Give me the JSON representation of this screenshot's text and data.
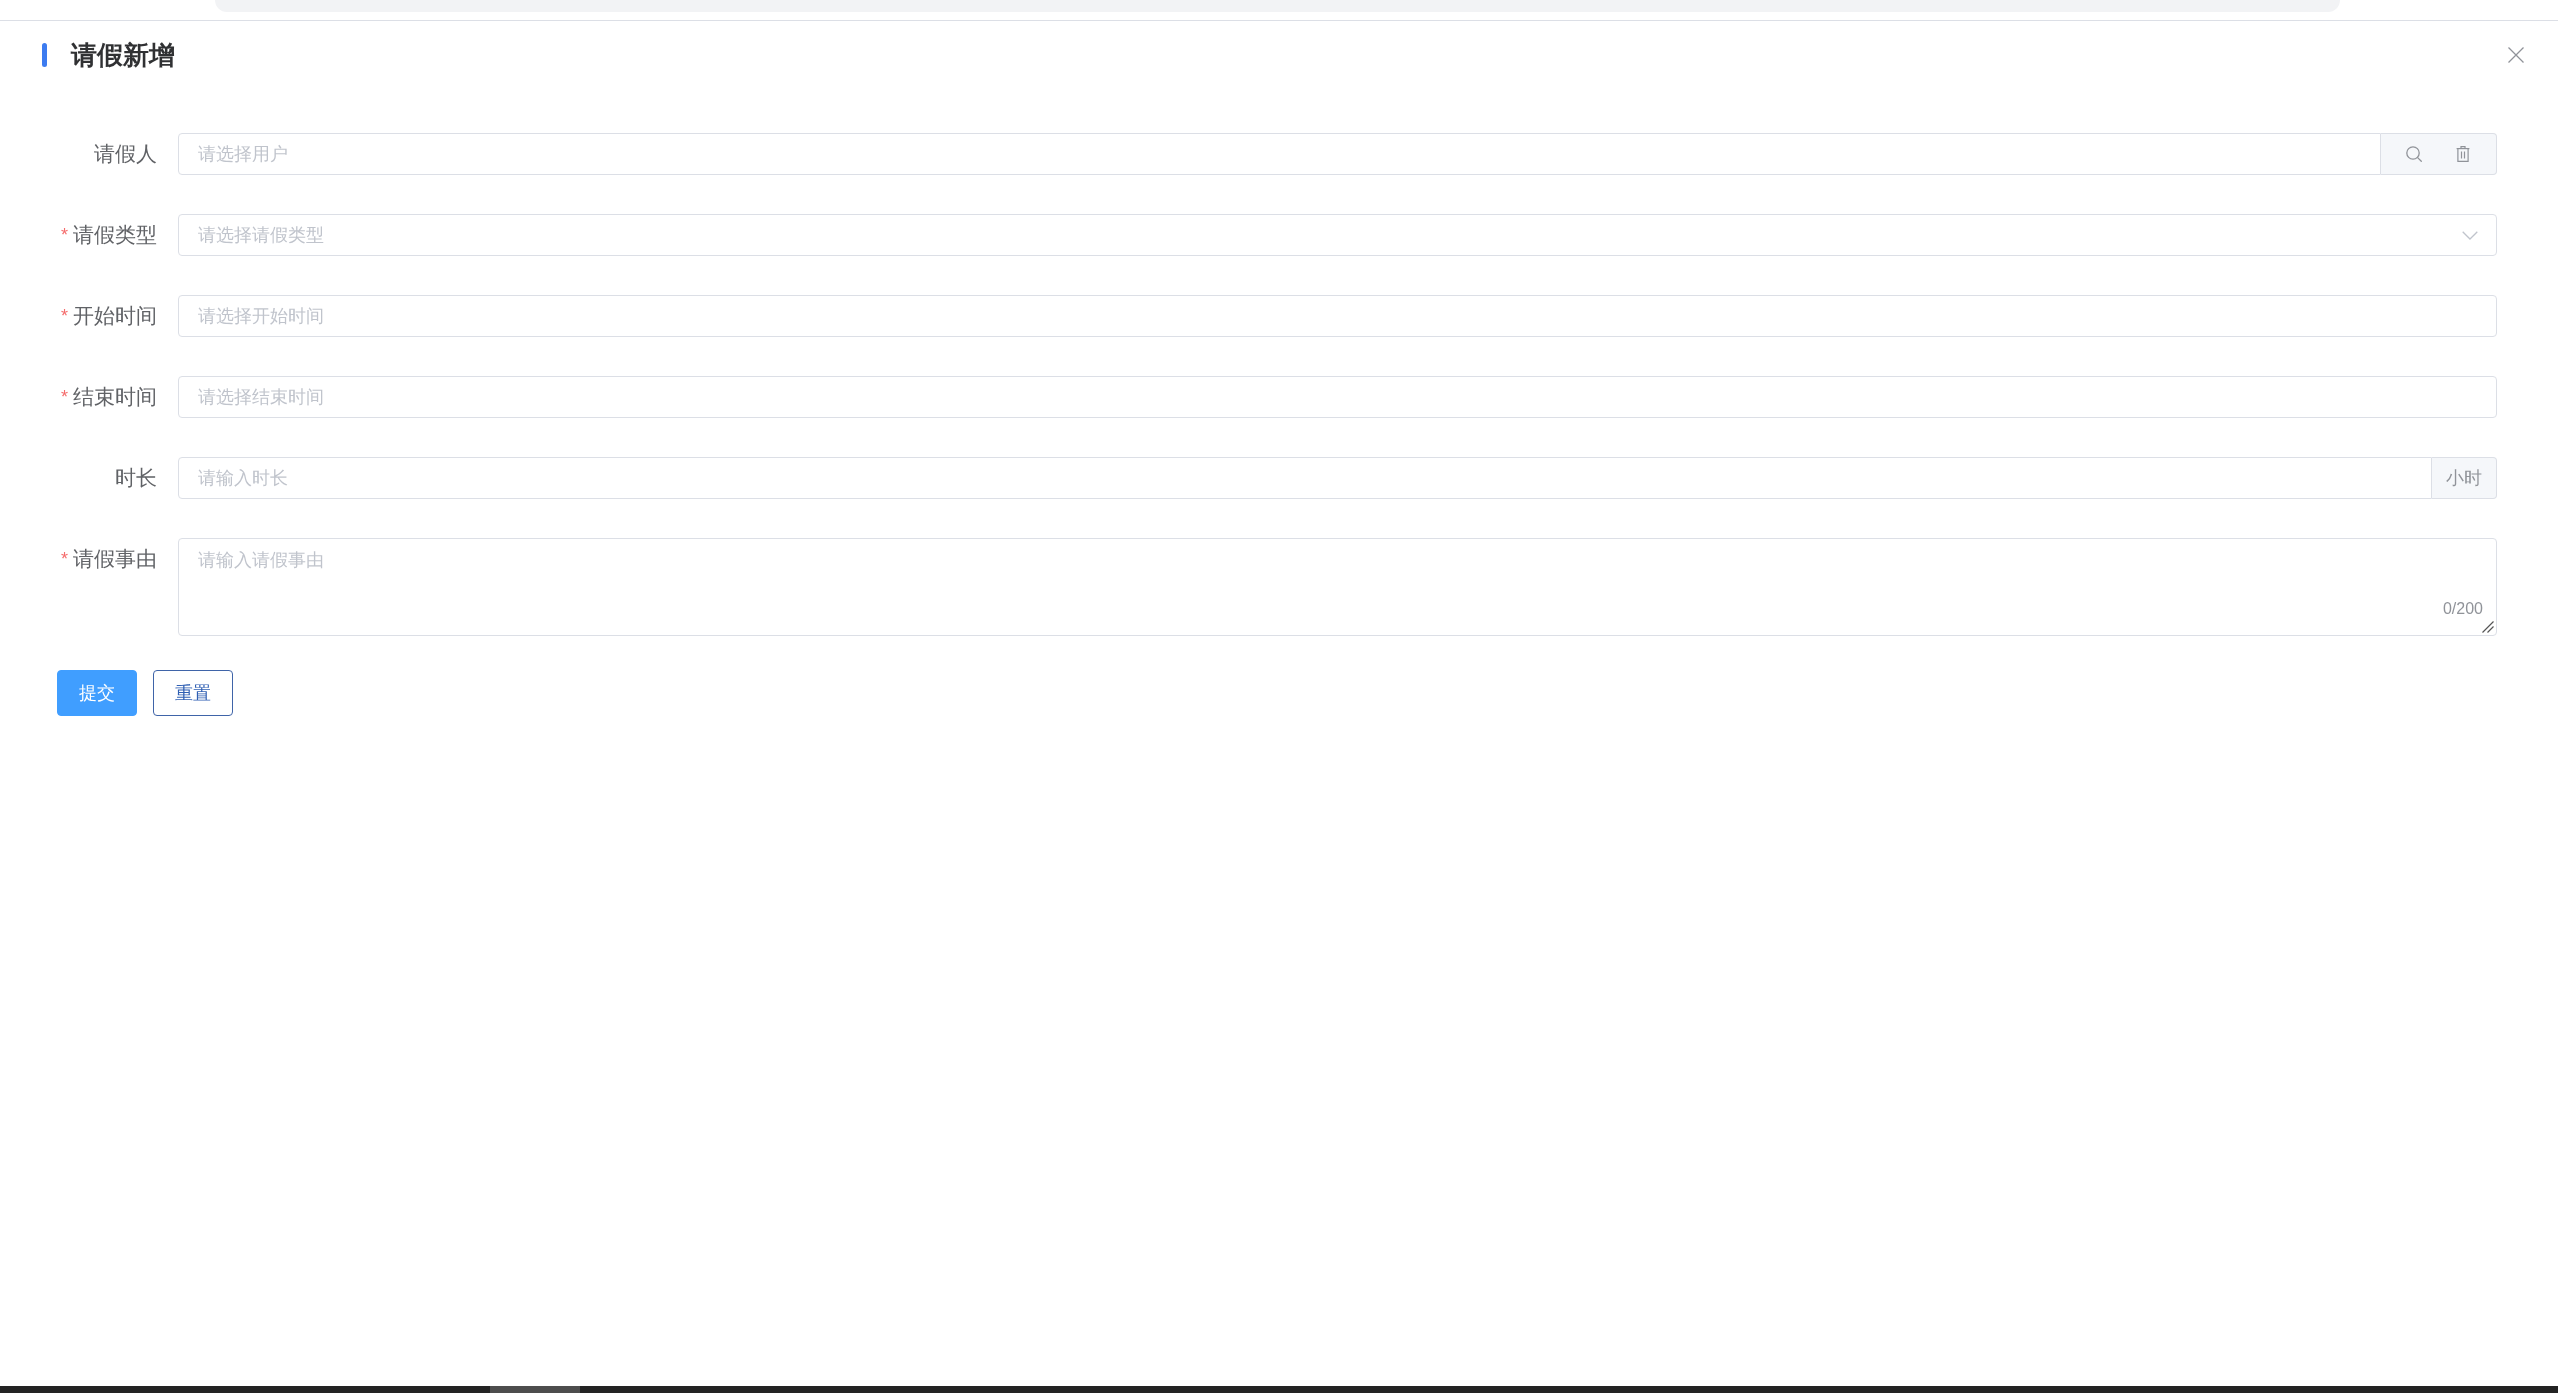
{
  "dialog": {
    "title": "请假新增"
  },
  "form": {
    "fields": [
      {
        "kind": "user_picker",
        "label": "请假人",
        "placeholder": "请选择用户"
      },
      {
        "kind": "select",
        "required_mark": "*",
        "label": "请假类型",
        "placeholder": "请选择请假类型"
      },
      {
        "kind": "date",
        "required_mark": "*",
        "label": "开始时间",
        "placeholder": "请选择开始时间"
      },
      {
        "kind": "date",
        "required_mark": "*",
        "label": "结束时间",
        "placeholder": "请选择结束时间"
      },
      {
        "kind": "number",
        "label": "时长",
        "placeholder": "请输入时长",
        "suffix": "小时"
      },
      {
        "kind": "textarea",
        "required_mark": "*",
        "label": "请假事由",
        "placeholder": "请输入请假事由",
        "counter": "0/200"
      }
    ]
  },
  "buttons": [
    {
      "kind": "primary",
      "label": "提交"
    },
    {
      "kind": "default",
      "label": "重置"
    }
  ]
}
